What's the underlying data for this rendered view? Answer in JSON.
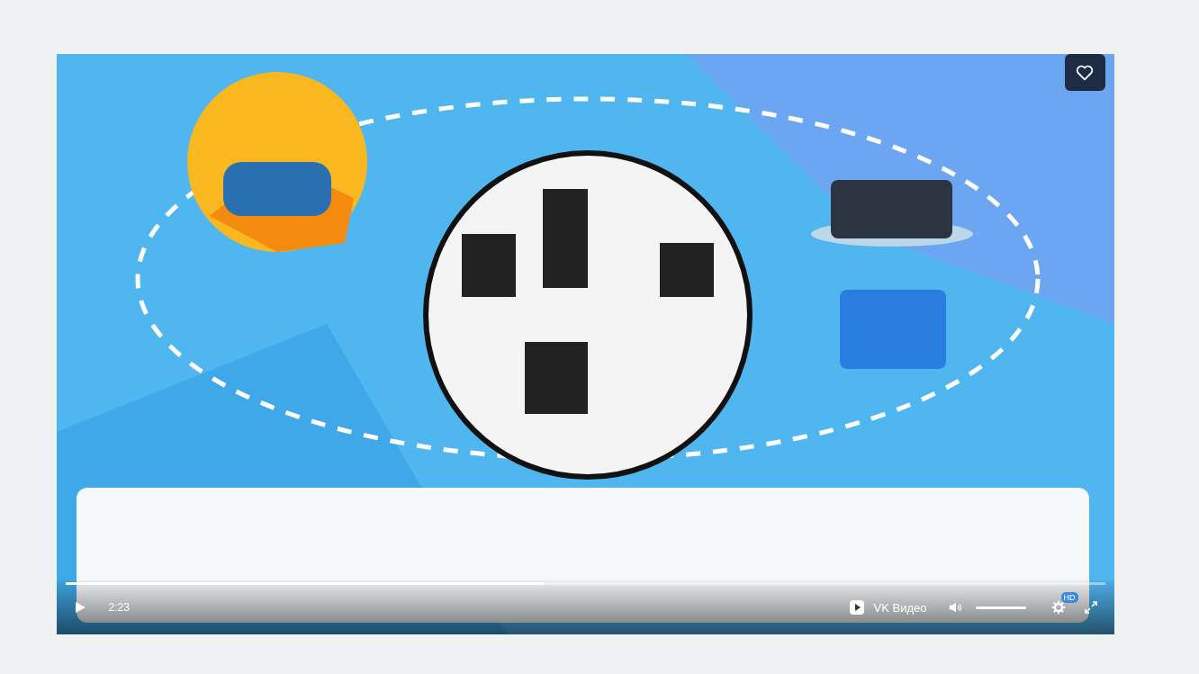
{
  "video": {
    "kind": "picture",
    "liked": false,
    "player": {
      "playing": false,
      "time": "2:23",
      "progress": {
        "level": 0.46
      },
      "brand": "VK Видео",
      "volume": {
        "level": 1
      },
      "quality_badge": "HD"
    }
  }
}
